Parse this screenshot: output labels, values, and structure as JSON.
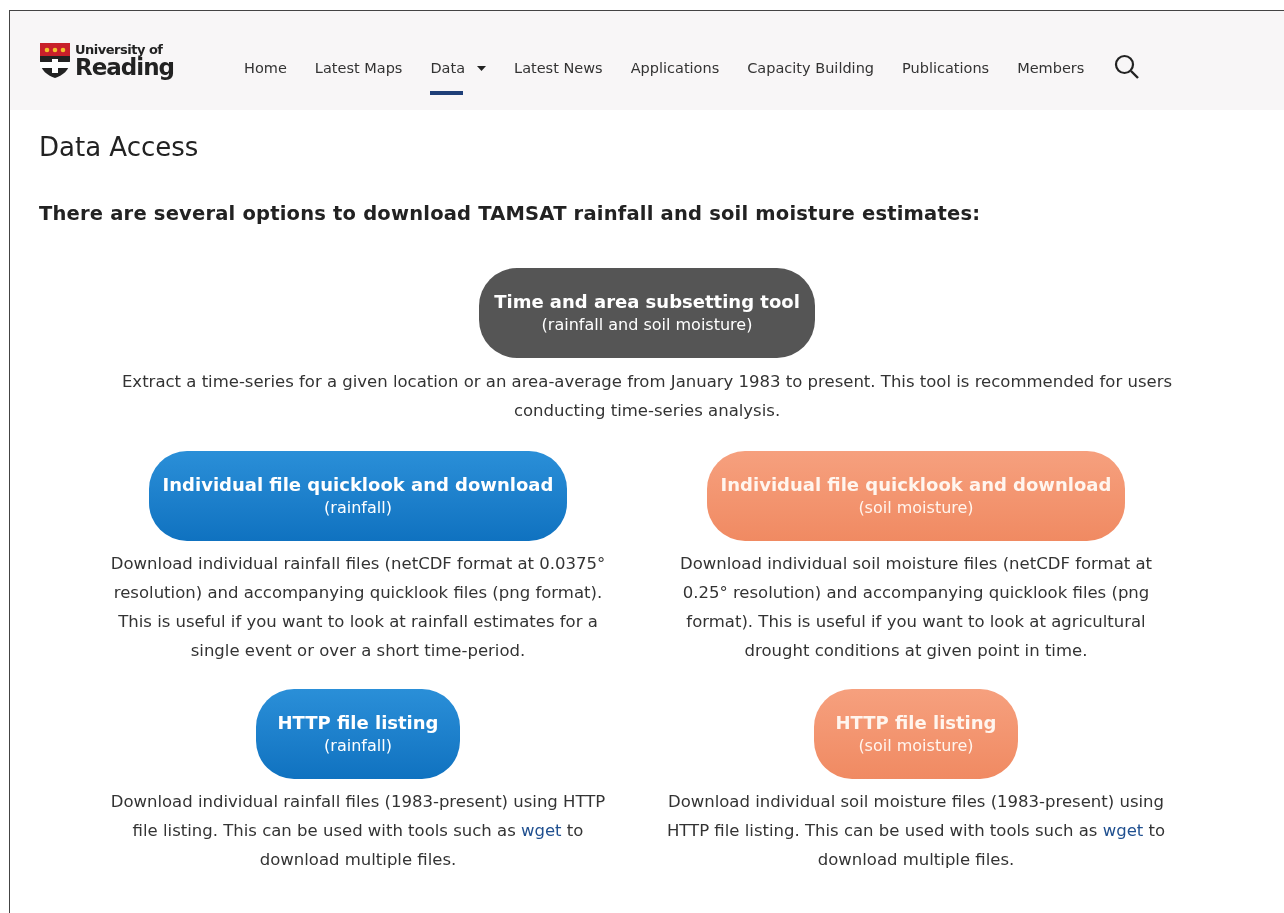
{
  "logo": {
    "line_1": "University of",
    "line_2": "Reading"
  },
  "nav": [
    {
      "label": "Home",
      "selected": false,
      "dropdown": false
    },
    {
      "label": "Latest Maps",
      "selected": false,
      "dropdown": false
    },
    {
      "label": "Data",
      "selected": true,
      "dropdown": true
    },
    {
      "label": "Latest News",
      "selected": false,
      "dropdown": false
    },
    {
      "label": "Applications",
      "selected": false,
      "dropdown": false
    },
    {
      "label": "Capacity Building",
      "selected": false,
      "dropdown": false
    },
    {
      "label": "Publications",
      "selected": false,
      "dropdown": false
    },
    {
      "label": "Members",
      "selected": false,
      "dropdown": false
    }
  ],
  "title": "Data Access",
  "intro": "There are several options to download TAMSAT rainfall and soil moisture estimates:",
  "featured": {
    "kind": "dark",
    "title": "Time and area subsetting tool",
    "subtitle": "(rainfall and soil moisture)",
    "description": [
      {
        "kind": "text",
        "text": "Extract a time-series for a given location or an area-average from January 1983 to present. This tool is recommended for users conducting time-series analysis."
      }
    ]
  },
  "options": [
    {
      "kind": "blue",
      "title": "Individual file quicklook and download",
      "subtitle": "(rainfall)",
      "description": [
        {
          "kind": "text",
          "text": "Download individual rainfall files (netCDF format at 0.0375° resolution) and accompanying quicklook files (png format). This is useful if you want to look at rainfall estimates for a single event or over a short time-period."
        }
      ]
    },
    {
      "kind": "orange",
      "title": "Individual file quicklook and download",
      "subtitle": "(soil moisture)",
      "description": [
        {
          "kind": "text",
          "text": "Download individual soil moisture files (netCDF format at 0.25° resolution) and accompanying quicklook files (png format). This is useful if you want to look at agricultural drought conditions at given point in time."
        }
      ]
    },
    {
      "kind": "blue",
      "title": "HTTP file listing",
      "subtitle": "(rainfall)",
      "description": [
        {
          "kind": "text",
          "text": "Download individual rainfall files (1983-present) using HTTP file listing. This can be used with tools such as "
        },
        {
          "kind": "link",
          "text": "wget"
        },
        {
          "kind": "text",
          "text": " to download multiple files."
        }
      ]
    },
    {
      "kind": "orange",
      "title": "HTTP file listing",
      "subtitle": "(soil moisture)",
      "description": [
        {
          "kind": "text",
          "text": "Download individual soil moisture files (1983-present) using HTTP file listing. This can be used with tools such as "
        },
        {
          "kind": "link",
          "text": "wget"
        },
        {
          "kind": "text",
          "text": " to download multiple files."
        }
      ]
    }
  ]
}
